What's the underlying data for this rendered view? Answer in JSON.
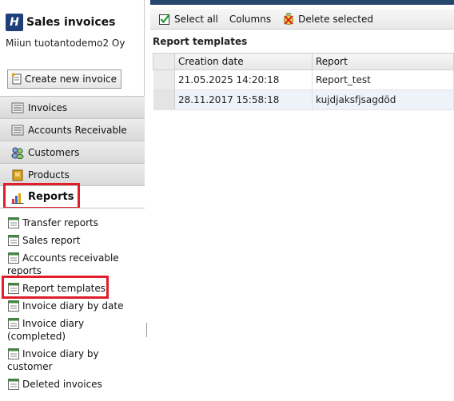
{
  "app": {
    "logo_text": "H",
    "title": "Sales invoices",
    "company": "Miiun tuotantodemo2 Oy"
  },
  "sidebar": {
    "create_button": "Create new invoice",
    "nav": [
      {
        "label": "Invoices",
        "icon": "list-icon"
      },
      {
        "label": "Accounts Receivable",
        "icon": "list-icon"
      },
      {
        "label": "Customers",
        "icon": "people-icon"
      },
      {
        "label": "Products",
        "icon": "box-icon"
      },
      {
        "label": "Reports",
        "icon": "bar-chart-icon",
        "active": true
      }
    ],
    "reports": [
      {
        "label": "Transfer reports"
      },
      {
        "label": "Sales report"
      },
      {
        "label": "Accounts receivable reports"
      },
      {
        "label": "Report templates",
        "highlighted": true
      },
      {
        "label": "Invoice diary by date"
      },
      {
        "label": "Invoice diary (completed)"
      },
      {
        "label": "Invoice diary by customer"
      },
      {
        "label": "Deleted invoices"
      }
    ]
  },
  "toolbar": {
    "select_all": "Select all",
    "columns": "Columns",
    "delete_selected": "Delete selected"
  },
  "main": {
    "section_title": "Report templates",
    "columns": [
      "Creation date",
      "Report"
    ],
    "rows": [
      {
        "date": "21.05.2025 14:20:18",
        "report": "Report_test"
      },
      {
        "date": "28.11.2017 15:58:18",
        "report": "kujdjaksfjsagdöd"
      }
    ]
  },
  "colors": {
    "header_bar": "#27466e",
    "highlight": "#e01e2a",
    "logo": "#1f3f7a"
  }
}
